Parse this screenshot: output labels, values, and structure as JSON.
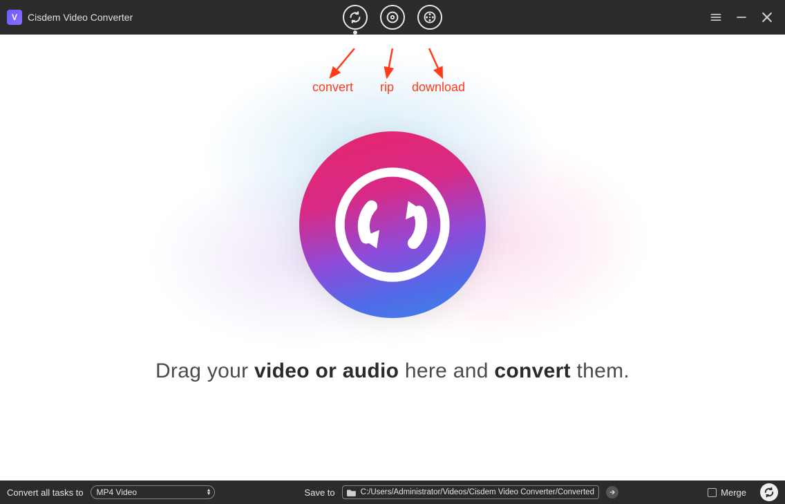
{
  "app": {
    "title": "Cisdem Video Converter",
    "logo_letter": "V"
  },
  "tabs": {
    "convert_tooltip": "Convert",
    "rip_tooltip": "Rip",
    "download_tooltip": "Download"
  },
  "annotations": {
    "convert": "convert",
    "rip": "rip",
    "download": "download",
    "color": "#ff3b1a"
  },
  "instruction": {
    "pre": "Drag your ",
    "bold1": "video or audio",
    "mid": " here and ",
    "bold2": "convert",
    "post": " them."
  },
  "bottom": {
    "convert_all_label": "Convert all tasks to",
    "format_selected": "MP4 Video",
    "save_to_label": "Save to",
    "save_path": "C:/Users/Administrator/Videos/Cisdem Video Converter/Converted",
    "merge_label": "Merge"
  }
}
